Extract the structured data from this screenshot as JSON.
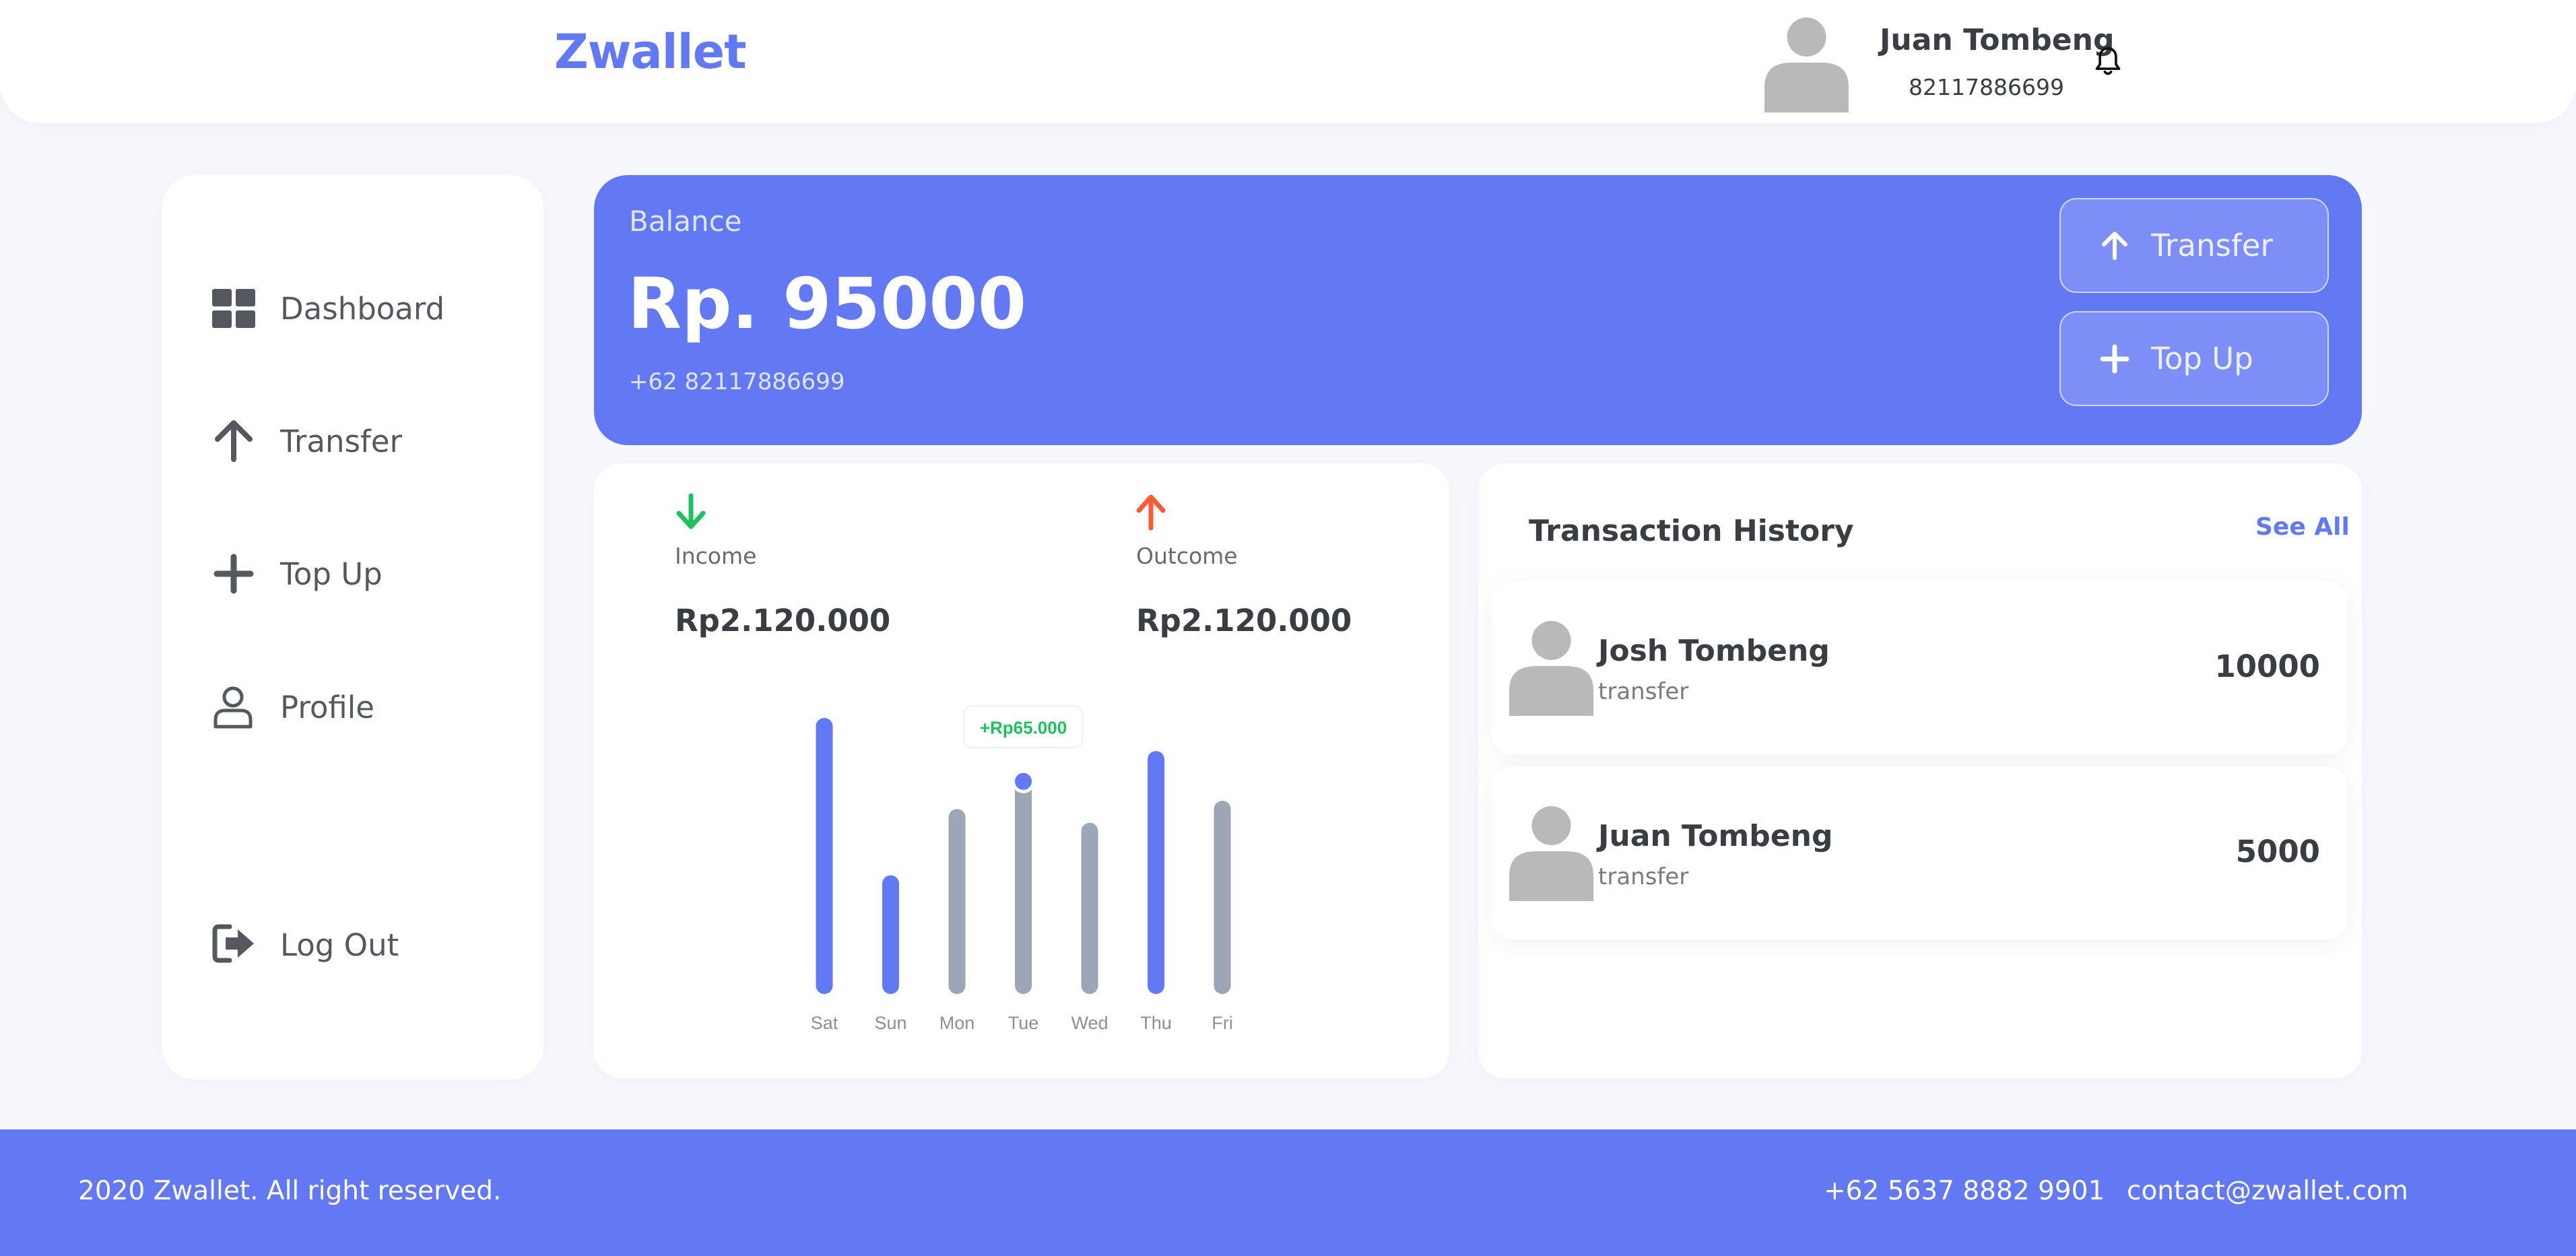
{
  "header": {
    "brand": "Zwallet",
    "user_name": "Juan Tombeng",
    "user_phone": "82117886699",
    "notification_icon": "bell-icon"
  },
  "sidebar": {
    "items": [
      {
        "label": "Dashboard",
        "icon": "dashboard-grid-icon"
      },
      {
        "label": "Transfer",
        "icon": "arrow-up-icon"
      },
      {
        "label": "Top Up",
        "icon": "plus-icon"
      },
      {
        "label": "Profile",
        "icon": "user-outline-icon"
      }
    ],
    "logout": {
      "label": "Log Out",
      "icon": "logout-icon"
    }
  },
  "balance": {
    "label": "Balance",
    "amount": "Rp. 95000",
    "phone": "+62 82117886699",
    "actions": [
      {
        "label": "Transfer",
        "icon": "arrow-up-icon"
      },
      {
        "label": "Top Up",
        "icon": "plus-icon"
      }
    ]
  },
  "stats": {
    "income": {
      "label": "Income",
      "value": "Rp2.120.000",
      "icon": "arrow-down-icon",
      "color": "#1ec15f"
    },
    "outcome": {
      "label": "Outcome",
      "value": "Rp2.120.000",
      "icon": "arrow-up-icon",
      "color": "#ff5b37"
    }
  },
  "chart_data": {
    "type": "bar",
    "categories": [
      "Sat",
      "Sun",
      "Mon",
      "Tue",
      "Wed",
      "Thu",
      "Fri"
    ],
    "values": [
      100,
      43,
      67,
      77,
      62,
      88,
      70
    ],
    "highlighted": [
      true,
      true,
      false,
      false,
      false,
      true,
      false
    ],
    "tooltip": {
      "category": "Tue",
      "label": "+Rp65.000"
    },
    "highlight_color": "#6379f4",
    "base_color": "#9da6b5",
    "tooltip_color": "#1ec15f"
  },
  "history": {
    "title": "Transaction History",
    "see_all": "See All",
    "items": [
      {
        "name": "Josh Tombeng",
        "type": "transfer",
        "amount": "10000"
      },
      {
        "name": "Juan Tombeng",
        "type": "transfer",
        "amount": "5000"
      }
    ]
  },
  "footer": {
    "copyright": "2020 Zwallet. All right reserved.",
    "phone": "+62 5637 8882 9901",
    "email": "contact@zwallet.com"
  },
  "colors": {
    "primary": "#6379f4",
    "background": "#f7f8fd",
    "text": "#3a3d42"
  }
}
